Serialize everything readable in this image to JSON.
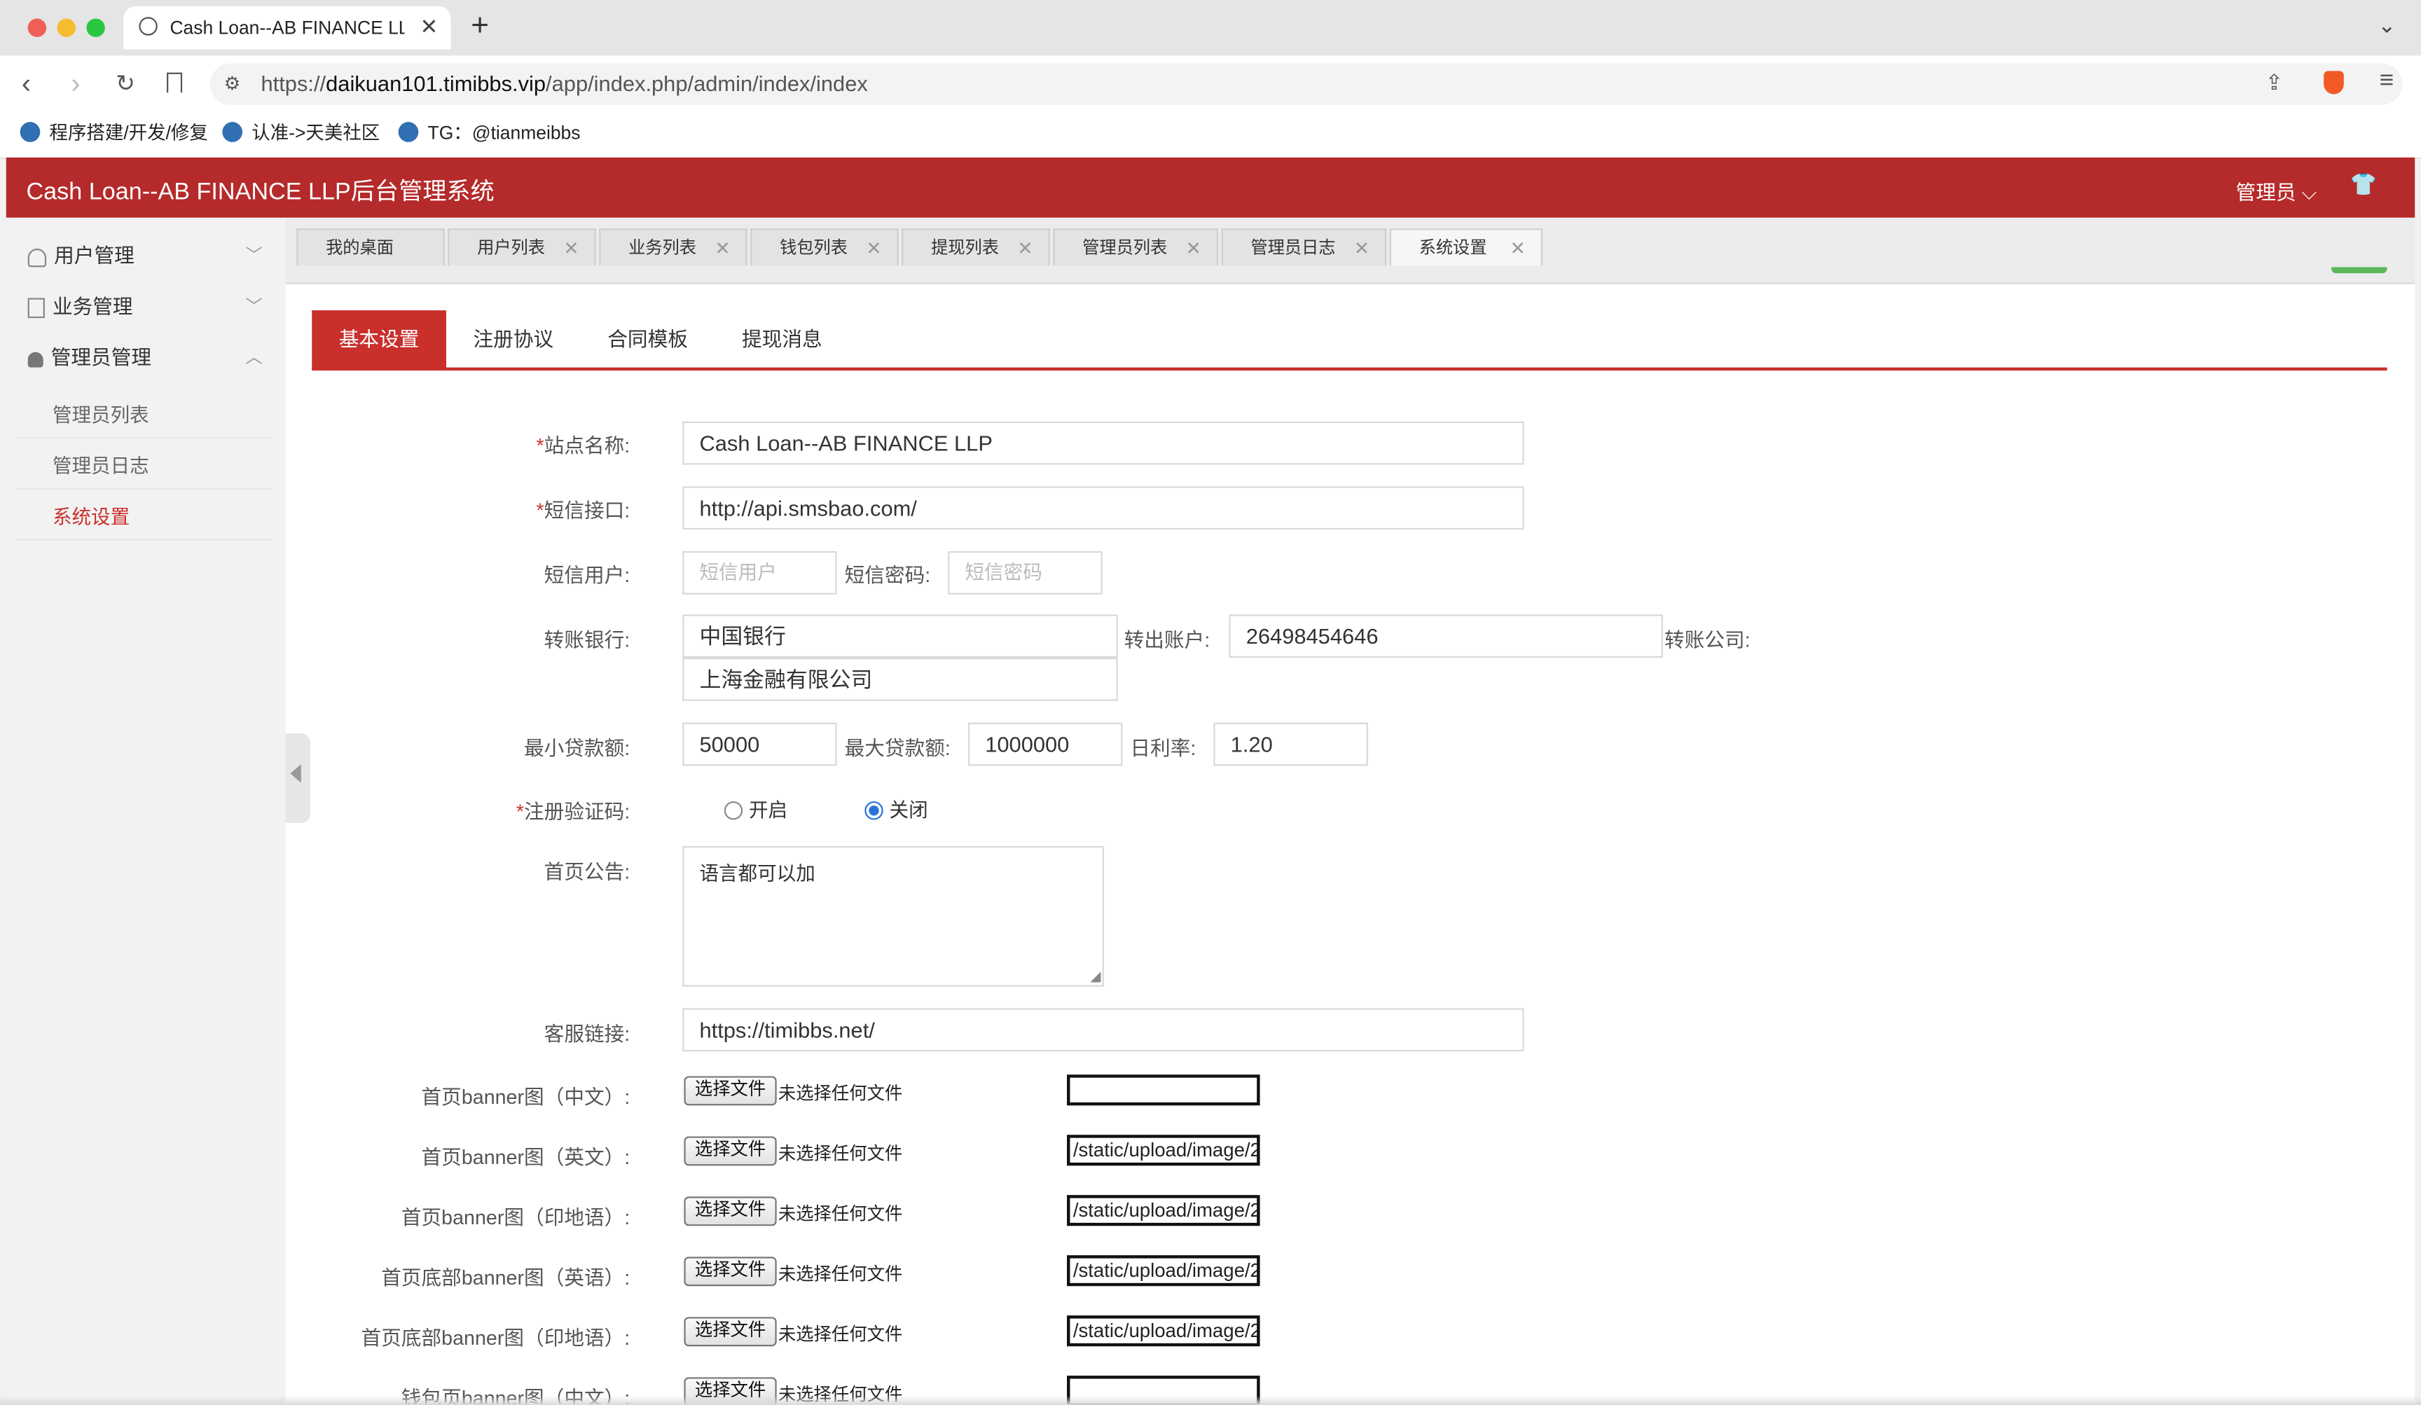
{
  "browser": {
    "tab_title": "Cash Loan--AB FINANCE LLP",
    "url_prefix": "https://",
    "url_host": "daikuan101.timibbs.vip",
    "url_path": "/app/index.php/admin/index/index",
    "bookmarks": [
      "程序搭建/开发/修复",
      "认准->天美社区",
      "TG：@tianmeibbs"
    ]
  },
  "app": {
    "title": "Cash Loan--AB FINANCE LLP后台管理系统",
    "user_menu": "管理员"
  },
  "sidebar": {
    "items": [
      {
        "label": "用户管理",
        "icon": "user-outline-icon",
        "expanded": false
      },
      {
        "label": "业务管理",
        "icon": "document-icon",
        "expanded": false
      },
      {
        "label": "管理员管理",
        "icon": "user-solid-icon",
        "expanded": true
      }
    ],
    "sub_items": [
      "管理员列表",
      "管理员日志",
      "系统设置"
    ],
    "active_sub": "系统设置"
  },
  "page_tabs": [
    "我的桌面",
    "用户列表",
    "业务列表",
    "钱包列表",
    "提现列表",
    "管理员列表",
    "管理员日志",
    "系统设置"
  ],
  "settings_tabs": [
    "基本设置",
    "注册协议",
    "合同模板",
    "提现消息"
  ],
  "form": {
    "site_name_label": "站点名称:",
    "site_name": "Cash Loan--AB FINANCE LLP",
    "sms_api_label": "短信接口:",
    "sms_api": "http://api.smsbao.com/",
    "sms_user_label": "短信用户:",
    "sms_user_placeholder": "短信用户",
    "sms_pass_label": "短信密码:",
    "sms_pass_placeholder": "短信密码",
    "bank_label": "转账银行:",
    "bank": "中国银行",
    "account_label": "转出账户:",
    "account": "26498454646",
    "company_label": "转账公司:",
    "company": "上海金融有限公司",
    "min_loan_label": "最小贷款额:",
    "min_loan": "50000",
    "max_loan_label": "最大贷款额:",
    "max_loan": "1000000",
    "daily_rate_label": "日利率:",
    "daily_rate": "1.20",
    "captcha_label": "注册验证码:",
    "captcha_on": "开启",
    "captcha_off": "关闭",
    "captcha_selected": "关闭",
    "notice_label": "首页公告:",
    "notice": "语言都可以加",
    "service_label": "客服链接:",
    "service": "https://timibbs.net/",
    "upload_button": "选择文件",
    "upload_none": "未选择任何文件",
    "uploads": [
      {
        "label": "首页banner图（中文）:",
        "path": ""
      },
      {
        "label": "首页banner图（英文）:",
        "path": "/static/upload/image/2"
      },
      {
        "label": "首页banner图（印地语）:",
        "path": "/static/upload/image/2"
      },
      {
        "label": "首页底部banner图（英语）:",
        "path": "/static/upload/image/2"
      },
      {
        "label": "首页底部banner图（印地语）:",
        "path": "/static/upload/image/2"
      },
      {
        "label": "钱包页banner图（中文）:",
        "path": ""
      }
    ]
  },
  "colors": {
    "brand": "#b52a2a",
    "active_text": "#c9302c"
  }
}
